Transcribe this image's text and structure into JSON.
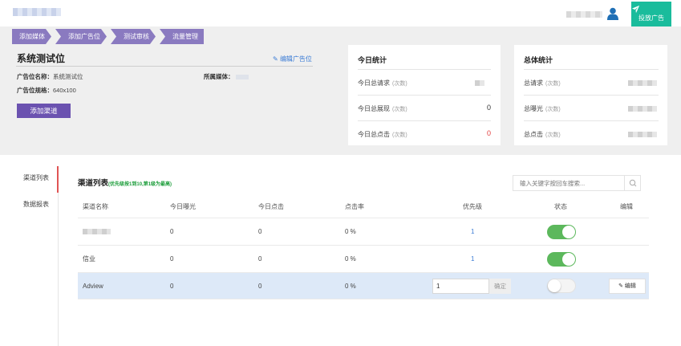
{
  "header": {
    "publish_label": "投放广告",
    "publish_icon": "paper-plane-icon",
    "user_icon": "user-icon"
  },
  "steps": [
    "添加媒体",
    "添加广告位",
    "测试审核",
    "流量管理"
  ],
  "position": {
    "title": "系统测试位",
    "edit_label": "编辑广告位",
    "name_label": "广告位名称：",
    "name_value": "系统测试位",
    "media_label": "所属媒体：",
    "size_label": "广告位规格：",
    "size_value": "640x100",
    "add_channel_label": "添加渠道"
  },
  "today": {
    "title": "今日统计",
    "rows": [
      {
        "label": "今日总请求",
        "unit": "(次数)",
        "value": ""
      },
      {
        "label": "今日总展现",
        "unit": "(次数)",
        "value": "0"
      },
      {
        "label": "今日总点击",
        "unit": "(次数)",
        "value": "0"
      }
    ]
  },
  "total": {
    "title": "总体统计",
    "rows": [
      {
        "label": "总请求",
        "unit": "(次数)"
      },
      {
        "label": "总曝光",
        "unit": "(次数)"
      },
      {
        "label": "总点击",
        "unit": "(次数)"
      }
    ]
  },
  "sidenav": [
    "渠道列表",
    "数据报表"
  ],
  "list": {
    "title": "渠道列表",
    "note": "(优先级按1到10,第1级为最高)",
    "search_placeholder": "输入关键字按回车搜索...",
    "columns": [
      "渠道名称",
      "今日曝光",
      "今日点击",
      "点击率",
      "优先级",
      "状态",
      "编辑"
    ],
    "rows": [
      {
        "name": "",
        "impressions": "0",
        "clicks": "0",
        "ctr": "0 %",
        "priority": "1",
        "status": "on"
      },
      {
        "name": "信业",
        "impressions": "0",
        "clicks": "0",
        "ctr": "0 %",
        "priority": "1",
        "status": "on"
      },
      {
        "name": "Adview",
        "impressions": "0",
        "clicks": "0",
        "ctr": "0 %",
        "priority": "1",
        "status": "off",
        "confirm_label": "确定",
        "edit_label": "编辑"
      }
    ]
  },
  "colors": {
    "accent_purple": "#6b52b0",
    "step_purple": "#8a7ac0",
    "publish_teal": "#1abc9c",
    "toggle_green": "#5cb85c",
    "alert_red": "#e23c3c",
    "highlight_row": "#dde9f8"
  }
}
